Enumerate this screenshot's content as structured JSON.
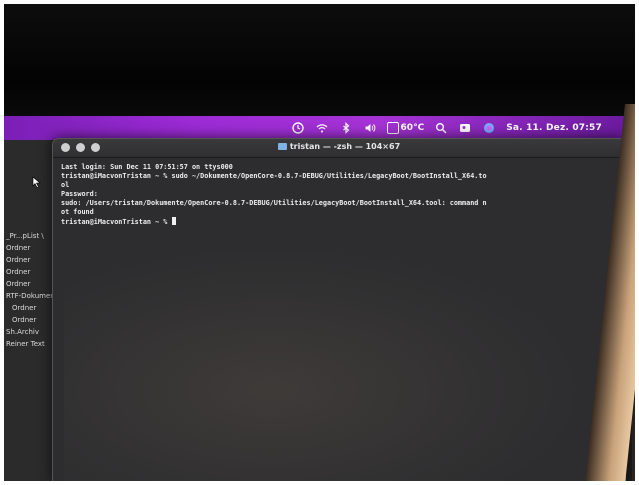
{
  "menubar": {
    "temperature": "60°C",
    "clock": "Sa. 11. Dez. 07:57",
    "icons": [
      "clock-icon",
      "wifi-icon",
      "bluetooth-icon",
      "volume-icon",
      "temperature-icon",
      "search-icon",
      "user-icon",
      "siri-icon"
    ]
  },
  "terminal": {
    "title": "tristan — -zsh — 104×67",
    "lines": [
      "Last login: Sun Dec 11 07:51:57 on ttys000",
      "tristan@iMacvonTristan ~ % sudo ~/Dokumente/OpenCore-0.8.7-DEBUG/Utilities/LegacyBoot/BootInstall_X64.to",
      "ol",
      "Password:",
      "sudo: /Users/tristan/Dokumente/OpenCore-0.8.7-DEBUG/Utilities/LegacyBoot/BootInstall_X64.tool: command n",
      "ot found",
      "tristan@iMacvonTristan ~ % "
    ]
  },
  "finder": {
    "items": [
      "_Pr...pList \\",
      "Ordner",
      "Ordner",
      "Ordner",
      "Ordner",
      "RTF-Dokument",
      "Ordner",
      "Ordner",
      "Sh.Archiv",
      "Reiner Text"
    ]
  },
  "colors": {
    "menubar_accent": "#9c2bd6",
    "terminal_bg": "#2d2d2f"
  }
}
